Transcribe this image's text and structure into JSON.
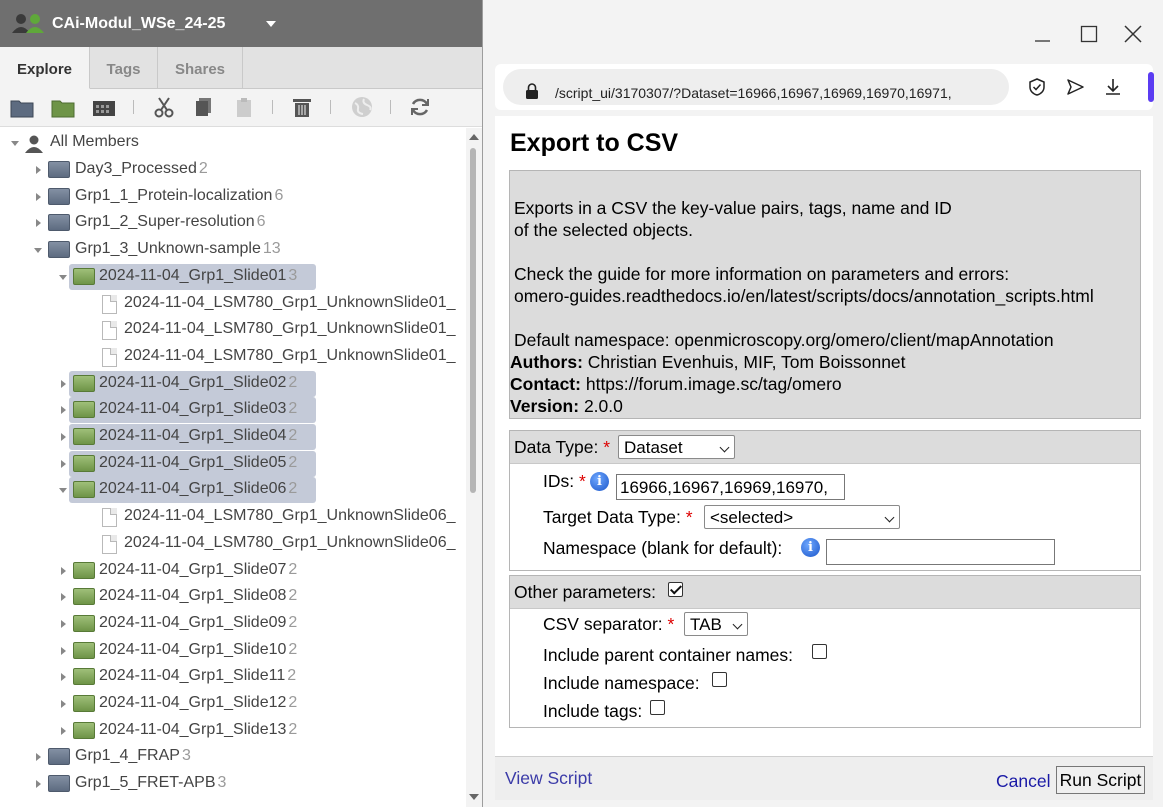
{
  "group_bar": {
    "title": "CAi-Modul_WSe_24-25"
  },
  "tabs": [
    {
      "label": "Explore",
      "active": true
    },
    {
      "label": "Tags",
      "active": false
    },
    {
      "label": "Shares",
      "active": false
    }
  ],
  "toolbar": {
    "icons": [
      "new-project-icon",
      "new-dataset-icon",
      "new-screen-icon",
      "cut-icon",
      "copy-icon",
      "paste-icon",
      "delete-icon",
      "globe-icon",
      "refresh-icon"
    ]
  },
  "tree": {
    "root": "All Members",
    "items": [
      {
        "label": "Day3_Processed",
        "count": "2",
        "kind": "project",
        "state": "closed",
        "level": 1
      },
      {
        "label": "Grp1_1_Protein-localization",
        "count": "6",
        "kind": "project",
        "state": "closed",
        "level": 1
      },
      {
        "label": "Grp1_2_Super-resolution",
        "count": "6",
        "kind": "project",
        "state": "closed",
        "level": 1
      },
      {
        "label": "Grp1_3_Unknown-sample",
        "count": "13",
        "kind": "project",
        "state": "open",
        "level": 1
      },
      {
        "label": "2024-11-04_Grp1_Slide01",
        "count": "3",
        "kind": "dataset",
        "state": "open",
        "level": 2,
        "selected": true
      },
      {
        "label": "2024-11-04_LSM780_Grp1_UnknownSlide01_",
        "kind": "image",
        "level": 3
      },
      {
        "label": "2024-11-04_LSM780_Grp1_UnknownSlide01_",
        "kind": "image",
        "level": 3
      },
      {
        "label": "2024-11-04_LSM780_Grp1_UnknownSlide01_",
        "kind": "image",
        "level": 3
      },
      {
        "label": "2024-11-04_Grp1_Slide02",
        "count": "2",
        "kind": "dataset",
        "state": "closed",
        "level": 2,
        "selected": true
      },
      {
        "label": "2024-11-04_Grp1_Slide03",
        "count": "2",
        "kind": "dataset",
        "state": "closed",
        "level": 2,
        "selected": true
      },
      {
        "label": "2024-11-04_Grp1_Slide04",
        "count": "2",
        "kind": "dataset",
        "state": "closed",
        "level": 2,
        "selected": true
      },
      {
        "label": "2024-11-04_Grp1_Slide05",
        "count": "2",
        "kind": "dataset",
        "state": "closed",
        "level": 2,
        "selected": true
      },
      {
        "label": "2024-11-04_Grp1_Slide06",
        "count": "2",
        "kind": "dataset",
        "state": "open",
        "level": 2,
        "selected": true
      },
      {
        "label": "2024-11-04_LSM780_Grp1_UnknownSlide06_",
        "kind": "image",
        "level": 3
      },
      {
        "label": "2024-11-04_LSM780_Grp1_UnknownSlide06_",
        "kind": "image",
        "level": 3
      },
      {
        "label": "2024-11-04_Grp1_Slide07",
        "count": "2",
        "kind": "dataset",
        "state": "closed",
        "level": 2
      },
      {
        "label": "2024-11-04_Grp1_Slide08",
        "count": "2",
        "kind": "dataset",
        "state": "closed",
        "level": 2
      },
      {
        "label": "2024-11-04_Grp1_Slide09",
        "count": "2",
        "kind": "dataset",
        "state": "closed",
        "level": 2
      },
      {
        "label": "2024-11-04_Grp1_Slide10",
        "count": "2",
        "kind": "dataset",
        "state": "closed",
        "level": 2
      },
      {
        "label": "2024-11-04_Grp1_Slide11",
        "count": "2",
        "kind": "dataset",
        "state": "closed",
        "level": 2
      },
      {
        "label": "2024-11-04_Grp1_Slide12",
        "count": "2",
        "kind": "dataset",
        "state": "closed",
        "level": 2
      },
      {
        "label": "2024-11-04_Grp1_Slide13",
        "count": "2",
        "kind": "dataset",
        "state": "closed",
        "level": 2
      },
      {
        "label": "Grp1_4_FRAP",
        "count": "3",
        "kind": "project",
        "state": "closed",
        "level": 1
      },
      {
        "label": "Grp1_5_FRET-APB",
        "count": "3",
        "kind": "project",
        "state": "closed",
        "level": 1
      }
    ]
  },
  "browser": {
    "url": "/script_ui/3170307/?Dataset=16966,16967,16969,16970,16971,"
  },
  "script": {
    "title": "Export to CSV",
    "desc_line1": "Exports in a CSV the key-value pairs, tags, name and ID",
    "desc_line2": "of the selected objects.",
    "desc_line3": "Check the guide for more information on parameters and errors:",
    "desc_line4": "omero-guides.readthedocs.io/en/latest/scripts/docs/annotation_scripts.html",
    "desc_line5": "Default namespace: openmicroscopy.org/omero/client/mapAnnotation",
    "authors_label": "Authors:",
    "authors_value": "Christian Evenhuis, MIF, Tom Boissonnet",
    "contact_label": "Contact:",
    "contact_value": "https://forum.image.sc/tag/omero",
    "version_label": "Version:",
    "version_value": "2.0.0"
  },
  "params": {
    "data_type_label": "Data Type:",
    "data_type_value": "Dataset",
    "ids_label": "IDs:",
    "ids_value": "16966,16967,16969,16970,",
    "target_label": "Target Data Type:",
    "target_value": "<selected>",
    "namespace_label": "Namespace (blank for default):",
    "namespace_value": ""
  },
  "other": {
    "header_label": "Other parameters:",
    "header_checked": true,
    "separator_label": "CSV separator:",
    "separator_value": "TAB",
    "parent_label": "Include parent container names:",
    "parent_checked": false,
    "namespace_label": "Include namespace:",
    "namespace_checked": false,
    "tags_label": "Include tags:",
    "tags_checked": false
  },
  "footer": {
    "view_script": "View Script",
    "cancel": "Cancel",
    "run": "Run Script"
  },
  "colors": {
    "accent": "#5b3cf2",
    "selection": "#c4cad8",
    "required": "#dd0000",
    "link": "#1a1aa6"
  }
}
